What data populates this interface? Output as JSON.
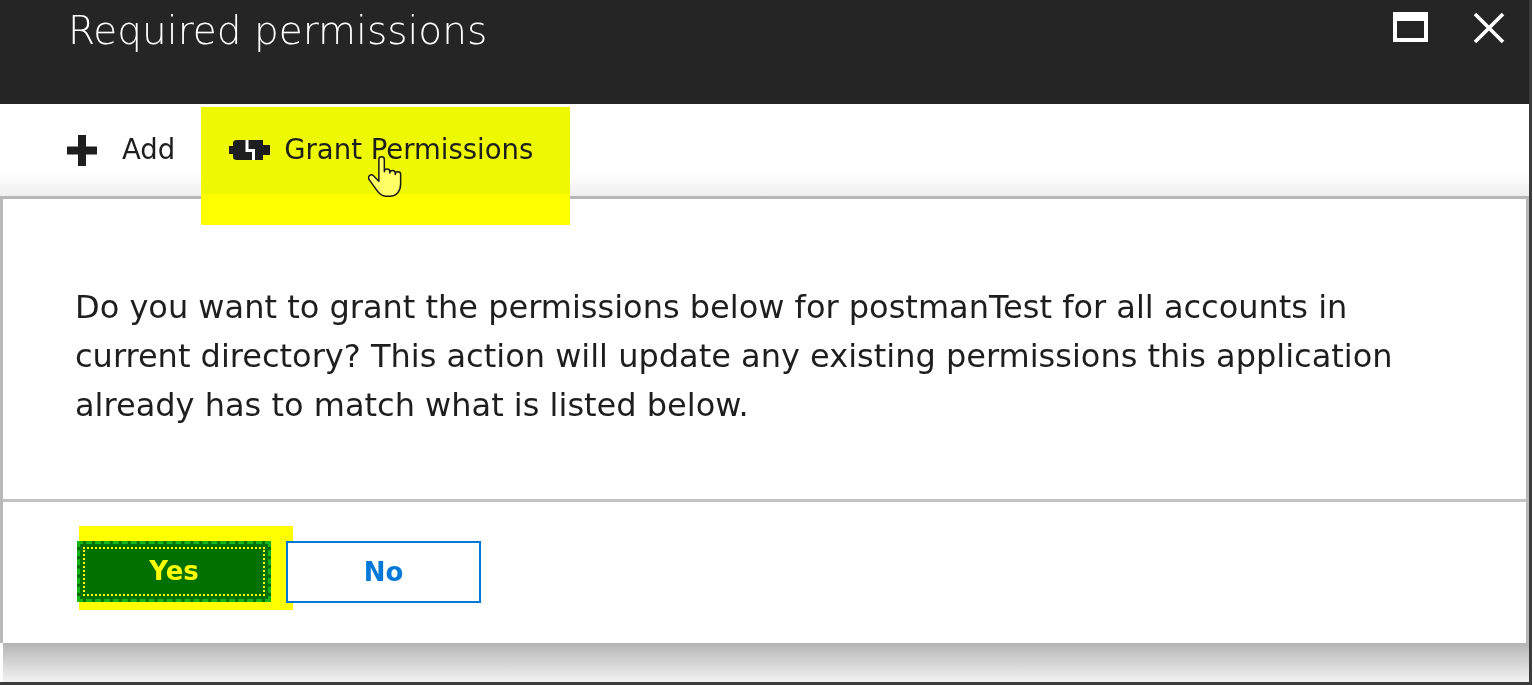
{
  "window": {
    "title": "Required permissions"
  },
  "toolbar": [
    {
      "label": "Add",
      "kind": "add",
      "highlighted": false,
      "hovered": false
    },
    {
      "label": "Grant Permissions",
      "kind": "grant",
      "highlighted": true,
      "hovered": true
    }
  ],
  "dialog": {
    "message": "Do you want to grant the permissions below for postmanTest for all accounts in current directory? This action will update any existing permissions this application already has to match what is listed below.",
    "buttons": [
      {
        "label": "Yes",
        "kind": "primary",
        "highlighted": true,
        "focused": true
      },
      {
        "label": "No",
        "kind": "secondary",
        "highlighted": false,
        "focused": false
      }
    ]
  }
}
